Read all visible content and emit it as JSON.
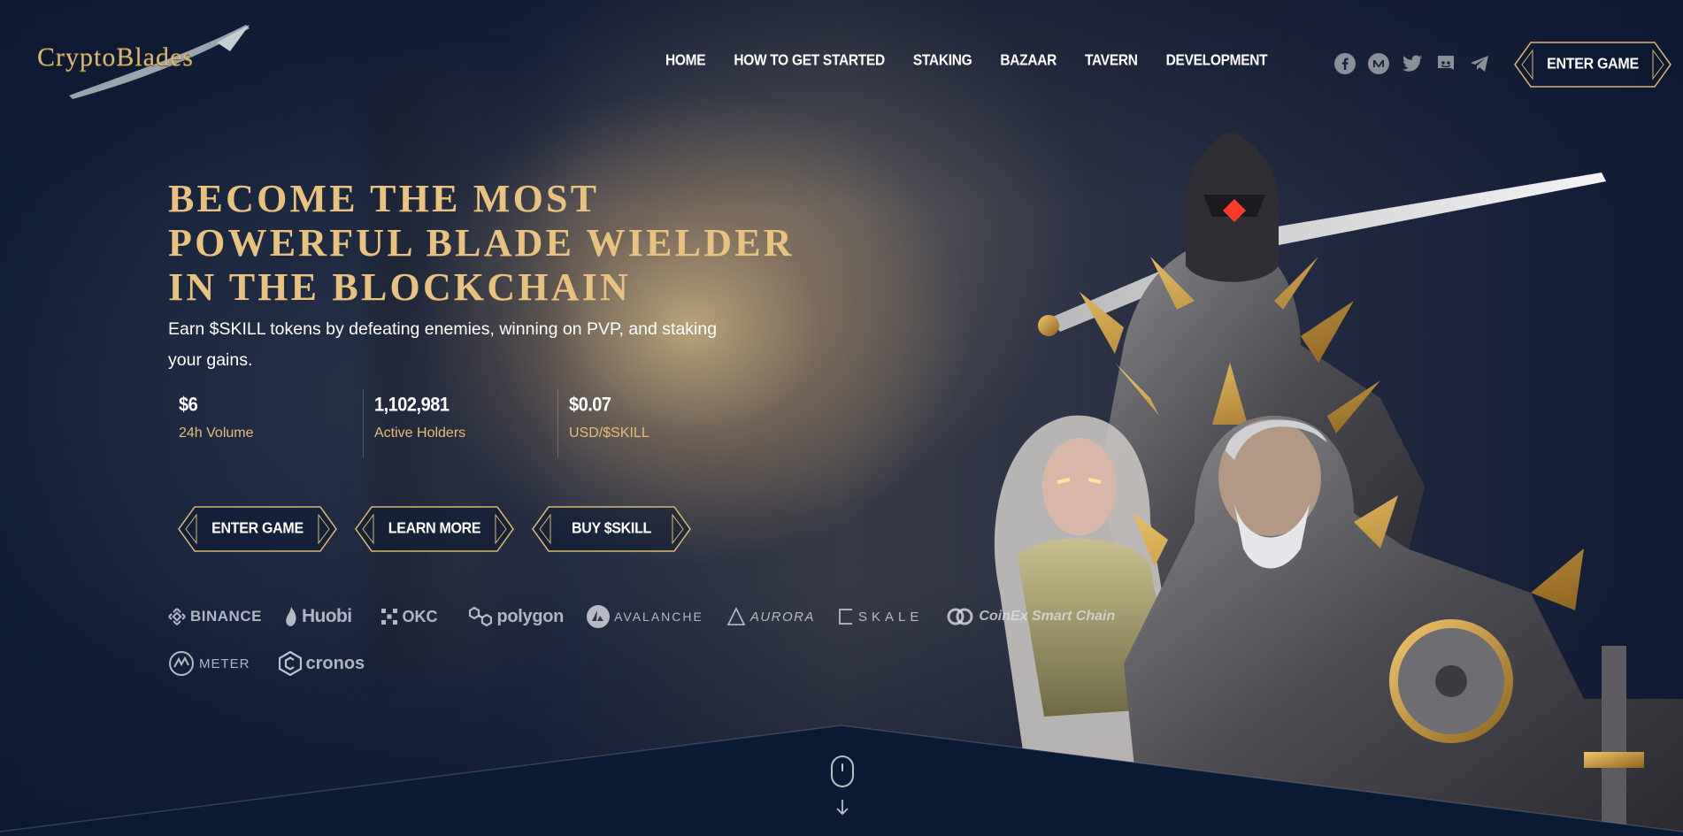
{
  "header": {
    "logo_text": "CryptoBlades",
    "nav": [
      "HOME",
      "HOW TO GET STARTED",
      "STAKING",
      "BAZAAR",
      "TAVERN",
      "DEVELOPMENT"
    ],
    "socials": [
      "facebook-icon",
      "medium-icon",
      "twitter-icon",
      "discord-icon",
      "telegram-icon"
    ],
    "enter_game_label": "ENTER GAME"
  },
  "hero": {
    "title_lines": [
      "BECOME THE MOST",
      "POWERFUL BLADE WIELDER",
      "IN THE BLOCKCHAIN"
    ],
    "subtitle": "Earn $SKILL tokens by defeating enemies, winning on PVP, and staking your gains.",
    "stats": [
      {
        "value": "$6",
        "label": "24h Volume"
      },
      {
        "value": "1,102,981",
        "label": "Active Holders"
      },
      {
        "value": "$0.07",
        "label": "USD/$SKILL"
      }
    ],
    "buttons": [
      "ENTER GAME",
      "LEARN MORE",
      "BUY $SKILL"
    ]
  },
  "exchanges": {
    "row1": [
      "BINANCE",
      "Huobi",
      "OKC",
      "polygon",
      "AVALANCHE",
      "AURORA",
      "SKALE",
      "CoinEx Smart Chain"
    ],
    "row2": [
      "METER",
      "cronos"
    ]
  },
  "colors": {
    "gold": "#e9c27f",
    "gold_label": "#e7bc74",
    "navy": "#0c1a33"
  }
}
